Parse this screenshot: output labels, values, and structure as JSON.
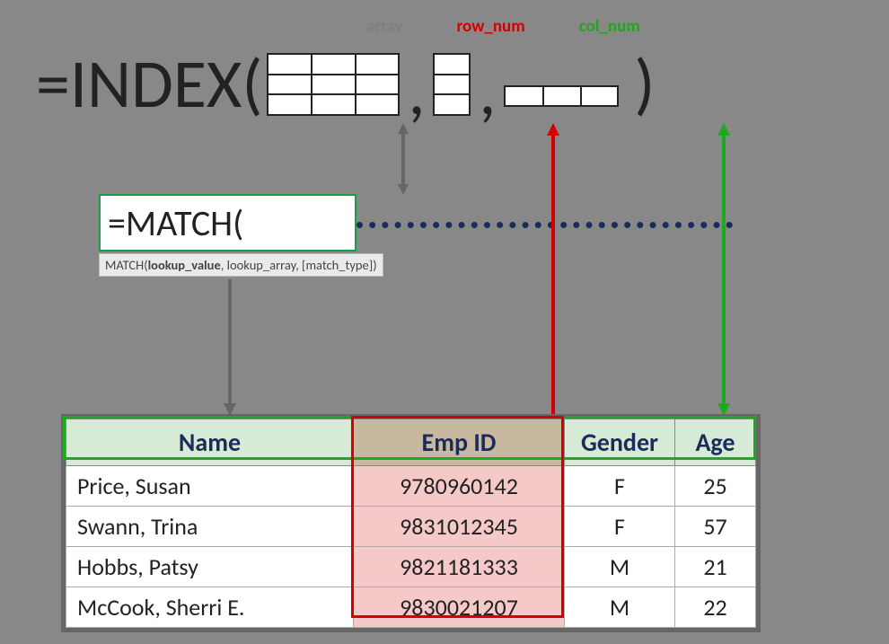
{
  "labels": {
    "array": "array",
    "row": "row_num",
    "col": "col_num"
  },
  "formula": {
    "eq": "=",
    "fn": "INDEX",
    "open": "(",
    "close": ")",
    "comma": ","
  },
  "match": {
    "text": "=MATCH(",
    "tip_pre": "MATCH(",
    "tip_b": "lookup_value",
    "tip_rest": ", lookup_array, [match_type])"
  },
  "table": {
    "headers": [
      "Name",
      "Emp ID",
      "Gender",
      "Age"
    ],
    "rows": [
      {
        "name": "Price, Susan",
        "emp": "9780960142",
        "gender": "F",
        "age": "25"
      },
      {
        "name": "Swann, Trina",
        "emp": "9831012345",
        "gender": "F",
        "age": "57"
      },
      {
        "name": "Hobbs, Patsy",
        "emp": "9821181333",
        "gender": "M",
        "age": "21"
      },
      {
        "name": "McCook, Sherri E.",
        "emp": "9830021207",
        "gender": "M",
        "age": "22"
      }
    ]
  }
}
